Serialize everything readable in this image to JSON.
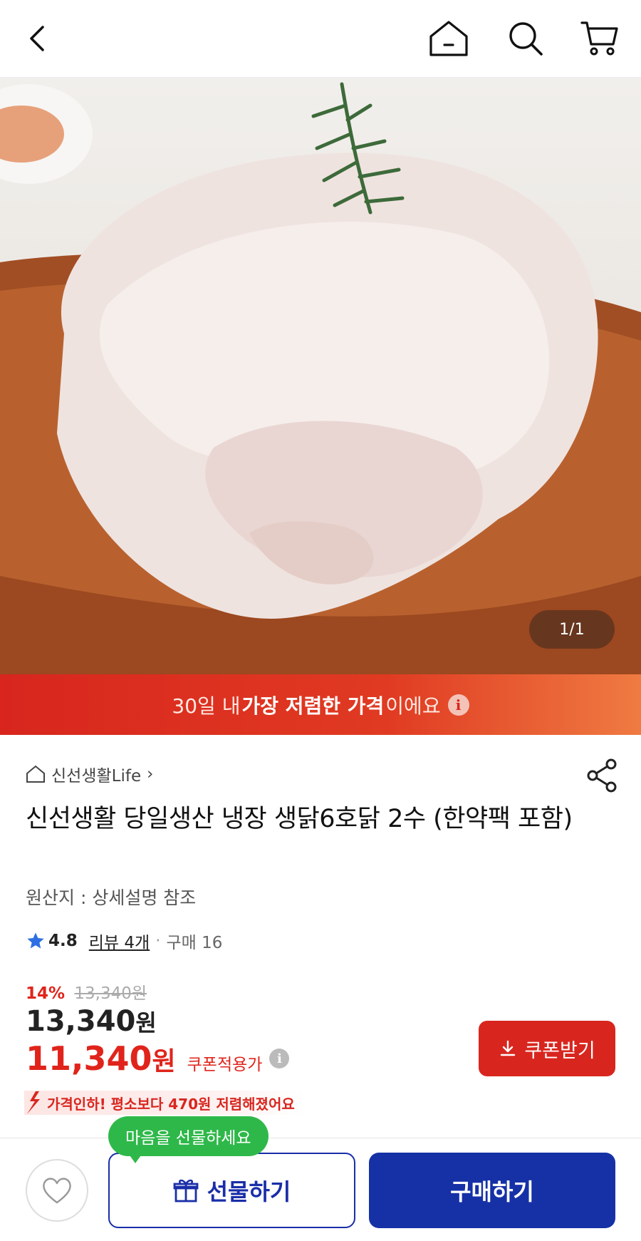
{
  "header": {
    "icons": [
      "back-arrow-icon",
      "home-icon",
      "search-icon",
      "cart-icon"
    ]
  },
  "hero": {
    "counter": "1/1",
    "image_desc_icon": "raw-chicken-photo"
  },
  "banner": {
    "pre": "30일 내",
    "strong": "가장 저렴한 가격",
    "post": "이에요",
    "info": "i",
    "bg_color": "#d8261e"
  },
  "seller": {
    "name": "신선생활Life",
    "chevron": "›"
  },
  "product": {
    "title": "신선생활 당일생산 냉장 생닭6호닭  2수 (한약팩 포함)",
    "origin": "원산지 : 상세설명 참조",
    "rating": "4.8",
    "reviews": "리뷰 4개",
    "separator": "·",
    "purchases": "구매 16",
    "discount_pct": "14%",
    "original_price": "13,340원",
    "price_number": "13,340",
    "price_unit": "원",
    "coupon_price_number": "11,340",
    "coupon_price_unit": "원",
    "coupon_label": "쿠폰적용가",
    "coupon_info": "i",
    "coupon_button": "쿠폰받기",
    "price_drop_text": "가격인하! 평소보다 470원 저렴해졌어요"
  },
  "bottom_bar": {
    "gift_tooltip": "마음을 선물하세요",
    "gift_button": "선물하기",
    "buy_button": "구매하기",
    "accent_color": "#1631a6",
    "tooltip_color": "#2fb84a"
  }
}
